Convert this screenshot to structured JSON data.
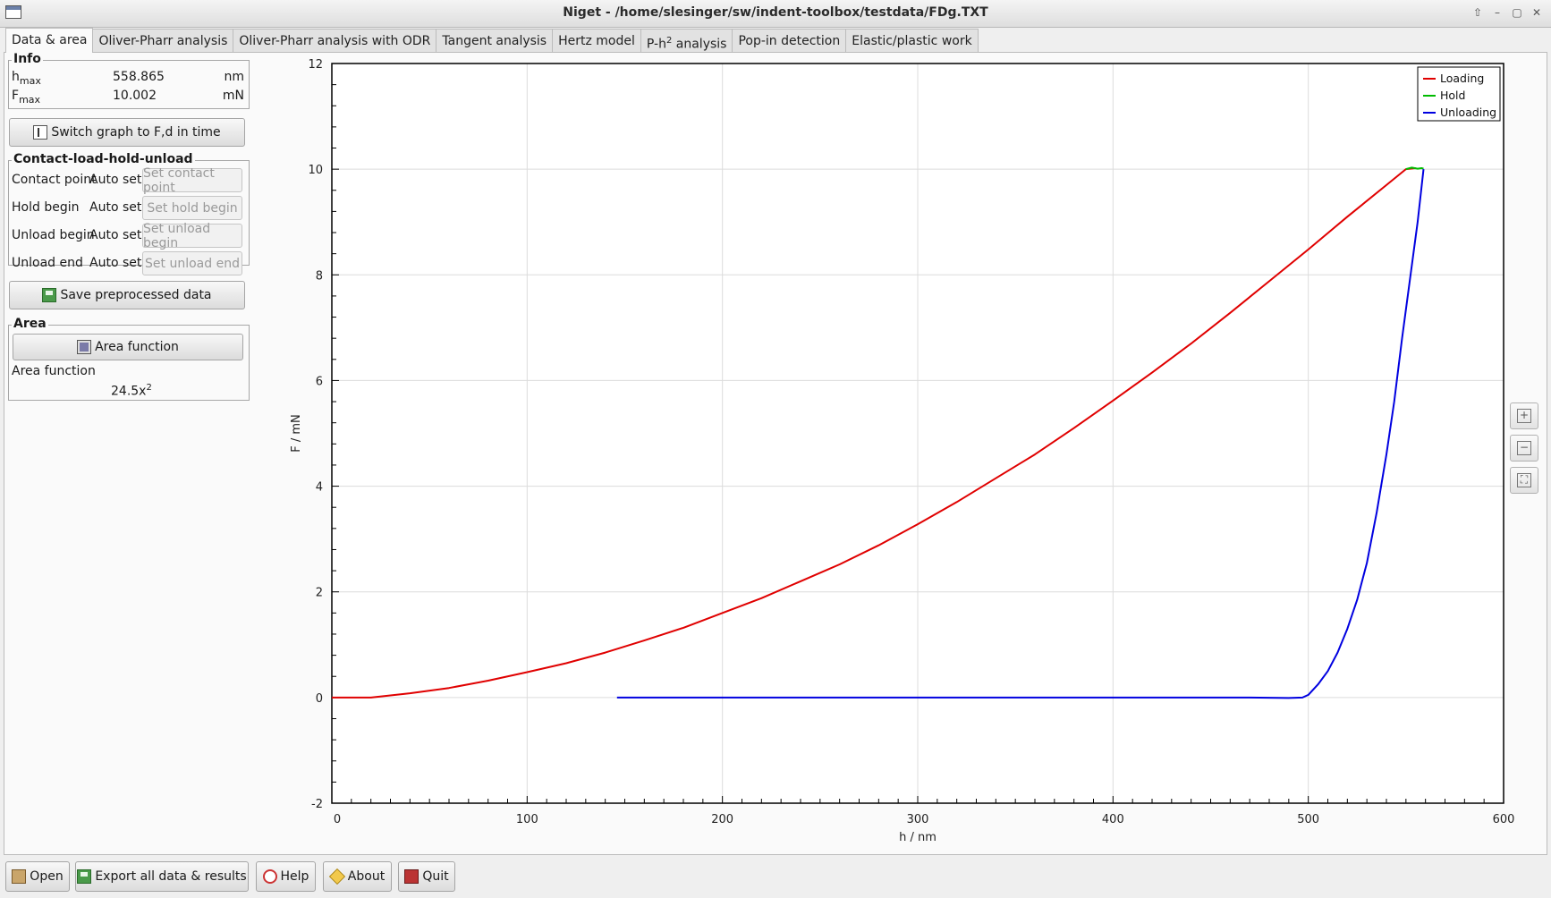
{
  "window": {
    "title": "Niget - /home/slesinger/sw/indent-toolbox/testdata/FDg.TXT"
  },
  "tabs": [
    {
      "label": "Data & area",
      "active": true
    },
    {
      "label": "Oliver-Pharr analysis"
    },
    {
      "label": "Oliver-Pharr analysis with ODR"
    },
    {
      "label": "Tangent analysis"
    },
    {
      "label": "Hertz model"
    },
    {
      "label": "P-h",
      "sup": "2",
      "suffix": " analysis"
    },
    {
      "label": "Pop-in detection"
    },
    {
      "label": "Elastic/plastic work"
    }
  ],
  "info": {
    "title": "Info",
    "hmax": {
      "label": "h",
      "sub": "max",
      "value": "558.865",
      "unit": "nm"
    },
    "fmax": {
      "label": "F",
      "sub": "max",
      "value": "10.002",
      "unit": "mN"
    }
  },
  "switch_graph_label": "Switch graph to F,d in time",
  "clhu": {
    "title": "Contact-load-hold-unload",
    "rows": [
      {
        "label": "Contact point",
        "status": "Auto set",
        "button": "Set contact point"
      },
      {
        "label": "Hold begin",
        "status": "Auto set",
        "button": "Set hold begin"
      },
      {
        "label": "Unload begin",
        "status": "Auto set",
        "button": "Set unload begin"
      },
      {
        "label": "Unload end",
        "status": "Auto set",
        "button": "Set unload end"
      }
    ]
  },
  "save_preprocessed_label": "Save preprocessed data",
  "area": {
    "title": "Area",
    "button": "Area function",
    "fn_label": "Area function",
    "fn_base": "24.5x",
    "fn_exp": "2"
  },
  "bottom": {
    "open": "Open",
    "export": "Export all data & results",
    "help": "Help",
    "about": "About",
    "quit": "Quit"
  },
  "colors": {
    "loading": "#e00000",
    "hold": "#00bb00",
    "unloading": "#0000e0"
  },
  "icons": [
    "graph-icon",
    "save-icon",
    "area-icon",
    "zoom-in-icon",
    "zoom-out-icon",
    "zoom-fit-icon",
    "open-icon",
    "export-icon",
    "help-icon",
    "about-icon",
    "quit-icon"
  ],
  "chart_data": {
    "type": "line",
    "xlabel": "h / nm",
    "ylabel": "F / mN",
    "xlim": [
      0,
      600
    ],
    "ylim": [
      -2,
      12
    ],
    "xticks": [
      0,
      100,
      200,
      300,
      400,
      500,
      600
    ],
    "yticks": [
      -2,
      0,
      2,
      4,
      6,
      8,
      10,
      12
    ],
    "grid": true,
    "legend_position": "top-right",
    "series": [
      {
        "name": "Loading",
        "color": "#e00000",
        "x": [
          0,
          20,
          40,
          60,
          80,
          100,
          120,
          140,
          160,
          180,
          200,
          220,
          240,
          260,
          280,
          300,
          320,
          340,
          360,
          380,
          400,
          420,
          440,
          460,
          480,
          500,
          520,
          540,
          550,
          555
        ],
        "y": [
          0,
          0,
          0.08,
          0.18,
          0.32,
          0.48,
          0.65,
          0.85,
          1.08,
          1.32,
          1.6,
          1.88,
          2.2,
          2.52,
          2.88,
          3.28,
          3.7,
          4.15,
          4.6,
          5.1,
          5.62,
          6.15,
          6.7,
          7.28,
          7.88,
          8.48,
          9.1,
          9.7,
          10.0,
          10.02
        ]
      },
      {
        "name": "Hold",
        "color": "#00bb00",
        "x": [
          550,
          553,
          556,
          558,
          559
        ],
        "y": [
          10.0,
          10.03,
          10.01,
          10.02,
          10.01
        ]
      },
      {
        "name": "Unloading",
        "color": "#0000e0",
        "x": [
          559,
          556,
          552,
          548,
          544,
          540,
          535,
          530,
          525,
          520,
          515,
          510,
          505,
          500,
          497,
          490,
          470,
          400,
          300,
          200,
          146
        ],
        "y": [
          10.0,
          9.0,
          7.9,
          6.8,
          5.6,
          4.6,
          3.5,
          2.55,
          1.85,
          1.3,
          0.85,
          0.5,
          0.25,
          0.05,
          0.0,
          -0.01,
          0.0,
          0.0,
          0.0,
          0.0,
          0.0
        ]
      }
    ]
  }
}
